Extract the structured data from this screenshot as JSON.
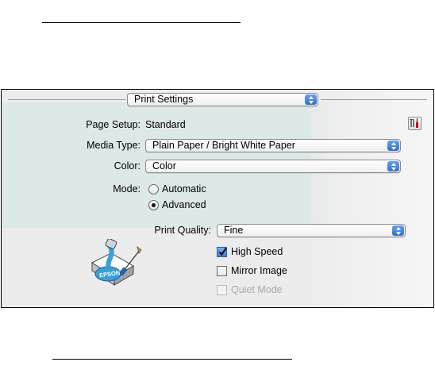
{
  "header": {
    "popup_label": "Print Settings"
  },
  "page_setup": {
    "label": "Page Setup:",
    "value": "Standard"
  },
  "media_type": {
    "label": "Media Type:",
    "value": "Plain Paper / Bright White Paper"
  },
  "color": {
    "label": "Color:",
    "value": "Color"
  },
  "mode": {
    "label": "Mode:",
    "options": [
      "Automatic",
      "Advanced"
    ],
    "selected": "Advanced"
  },
  "print_quality": {
    "label": "Print Quality:",
    "value": "Fine"
  },
  "options": [
    {
      "label": "High Speed",
      "checked": true,
      "enabled": true
    },
    {
      "label": "Mirror Image",
      "checked": false,
      "enabled": true
    },
    {
      "label": "Quiet Mode",
      "checked": false,
      "enabled": false
    }
  ],
  "logo": {
    "text": "EPSON"
  },
  "colors": {
    "accent": "#2f6fd0",
    "panel": "#dde8e8",
    "disabled": "#a8a8a8"
  }
}
